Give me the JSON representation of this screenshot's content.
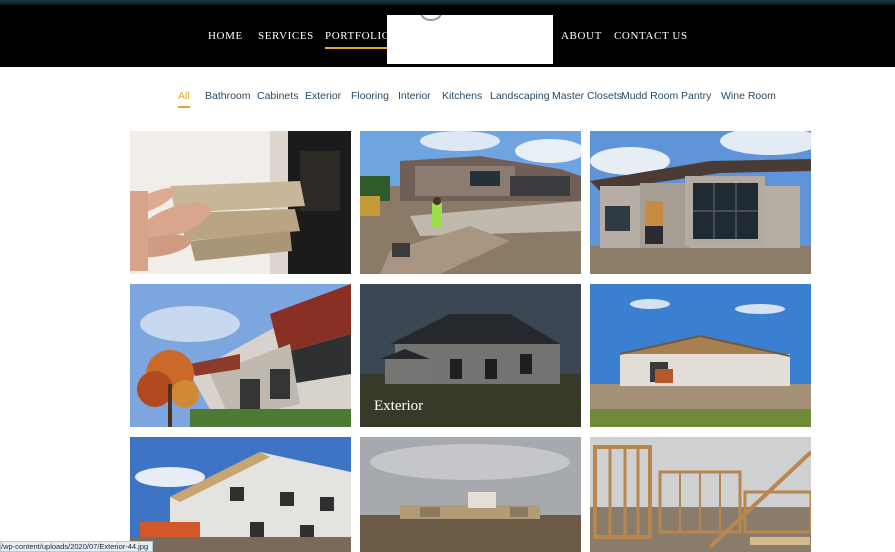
{
  "nav": {
    "items": [
      {
        "label": "HOME",
        "active": false
      },
      {
        "label": "SERVICES",
        "active": false
      },
      {
        "label": "PORTFOLIO",
        "active": true
      },
      {
        "label": "ABOUT",
        "active": false
      },
      {
        "label": "CONTACT US",
        "active": false
      }
    ],
    "accent_color": "#e3a833"
  },
  "filters": {
    "items": [
      "All",
      "Bathroom",
      "Cabinets",
      "Exterior",
      "Flooring",
      "Interior",
      "Kitchens",
      "Landscaping",
      "Master Closets",
      "Mudd Room",
      "Pantry",
      "Wine Room"
    ],
    "active": "All",
    "text_color": "#2c4a63"
  },
  "gallery": {
    "hover_caption": "Exterior"
  },
  "status_bar": {
    "url": "/wp-content/uploads/2020/07/Exterior-44.jpg"
  }
}
